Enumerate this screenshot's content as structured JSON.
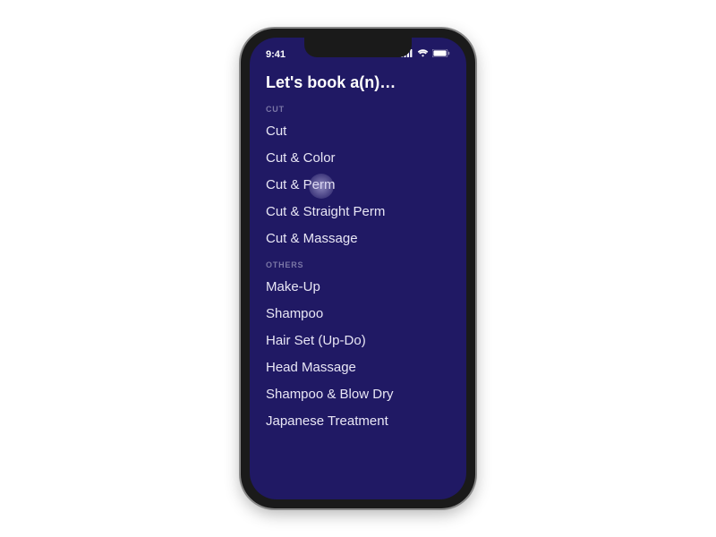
{
  "statusBar": {
    "time": "9:41"
  },
  "title": "Let's book a(n)…",
  "sections": [
    {
      "header": "CUT",
      "items": [
        "Cut",
        "Cut & Color",
        "Cut & Perm",
        "Cut & Straight Perm",
        "Cut & Massage"
      ]
    },
    {
      "header": "OTHERS",
      "items": [
        "Make-Up",
        "Shampoo",
        "Hair Set (Up-Do)",
        "Head Massage",
        "Shampoo & Blow Dry",
        "Japanese Treatment"
      ]
    }
  ],
  "colors": {
    "background": "#201964",
    "text": "#e8e6f5",
    "sectionHeader": "#7a76a6"
  }
}
